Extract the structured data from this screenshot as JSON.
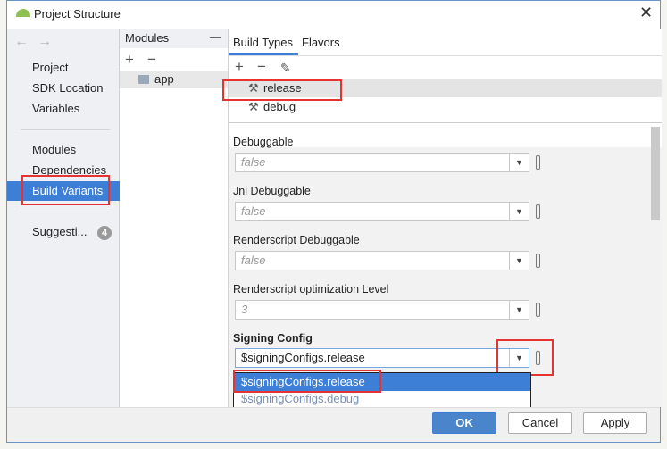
{
  "window": {
    "title": "Project Structure",
    "close": "✕"
  },
  "nav": {
    "back": "←",
    "forward": "→",
    "items": [
      "Project",
      "SDK Location",
      "Variables",
      "Modules",
      "Dependencies",
      "Build Variants",
      "Suggesti..."
    ],
    "suggestions_count": "4",
    "selected": "Build Variants"
  },
  "modules": {
    "header": "Modules",
    "collapse": "—",
    "add": "+",
    "remove": "−",
    "items": [
      "app"
    ]
  },
  "tabs": [
    "Build Types",
    "Flavors"
  ],
  "toolbar": {
    "add": "+",
    "remove": "−"
  },
  "build_types": [
    "release",
    "debug"
  ],
  "fields": [
    {
      "label": "Debuggable",
      "value": "false"
    },
    {
      "label": "Jni Debuggable",
      "value": "false"
    },
    {
      "label": "Renderscript Debuggable",
      "value": "false"
    },
    {
      "label": "Renderscript optimization Level",
      "value": "3"
    }
  ],
  "signing": {
    "label": "Signing Config",
    "value": "$signingConfigs.release",
    "options": [
      "$signingConfigs.release",
      "$signingConfigs.debug"
    ]
  },
  "buttons": {
    "ok": "OK",
    "cancel": "Cancel",
    "apply": "Apply"
  },
  "colors": {
    "accent": "#3d7ed6",
    "highlight": "#e53333"
  }
}
